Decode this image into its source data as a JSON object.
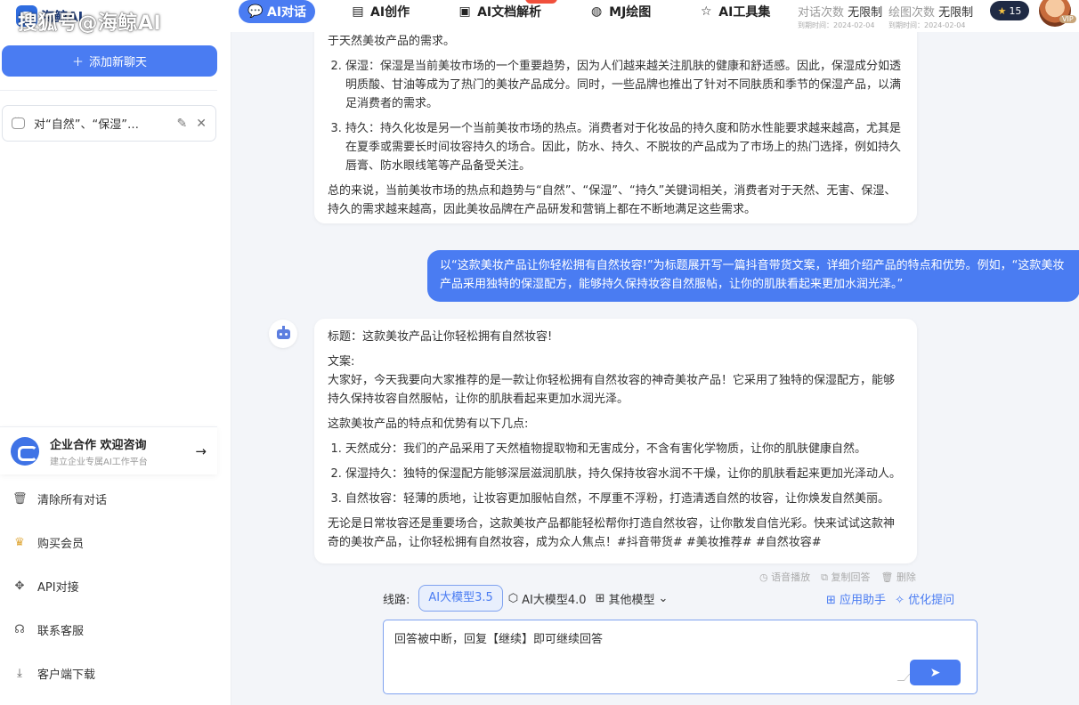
{
  "brand": {
    "name": "海鲸AI",
    "watermark": "搜狐号@海鲸AI"
  },
  "nav": [
    {
      "label": "AI对话",
      "icon": "chat-icon"
    },
    {
      "label": "AI创作",
      "icon": "document-icon"
    },
    {
      "label": "AI文档解析",
      "icon": "pdf-icon"
    },
    {
      "label": "MJ绘图",
      "icon": "palette-icon"
    },
    {
      "label": "AI工具集",
      "icon": "star-icon"
    }
  ],
  "quota": {
    "chat": {
      "label": "对话次数",
      "value": "无限制",
      "expiry": "到期时间：2024-02-04"
    },
    "draw": {
      "label": "绘图次数",
      "value": "无限制",
      "expiry": "到期时间：2024-02-04"
    }
  },
  "user": {
    "stars": "15",
    "vip": "VIP"
  },
  "sidebar": {
    "new_chat": "添加新聊天",
    "conversation_title": "对“自然”、“保湿”…",
    "enterprise": {
      "title": "企业合作 欢迎咨询",
      "subtitle": "建立企业专属AI工作平台"
    },
    "menu": [
      {
        "label": "清除所有对话",
        "icon": "trash-icon"
      },
      {
        "label": "购买会员",
        "icon": "crown-icon"
      },
      {
        "label": "API对接",
        "icon": "api-icon"
      },
      {
        "label": "联系客服",
        "icon": "headset-icon"
      },
      {
        "label": "客户端下载",
        "icon": "download-icon"
      }
    ]
  },
  "messages": {
    "first": {
      "intro_tail": "于天然美妆产品的需求。",
      "items": [
        "保湿：保湿是当前美妆市场的一个重要趋势，因为人们越来越关注肌肤的健康和舒适感。因此，保湿成分如透明质酸、甘油等成为了热门的美妆产品成分。同时，一些品牌也推出了针对不同肤质和季节的保湿产品，以满足消费者的需求。",
        "持久：持久化妆是另一个当前美妆市场的热点。消费者对于化妆品的持久度和防水性能要求越来越高，尤其是在夏季或需要长时间妆容持久的场合。因此，防水、持久、不脱妆的产品成为了市场上的热门选择，例如持久唇膏、防水眼线笔等产品备受关注。"
      ],
      "summary": "总的来说，当前美妆市场的热点和趋势与“自然”、“保湿”、“持久”关键词相关，消费者对于天然、无害、保湿、持久的需求越来越高，因此美妆品牌在产品研发和营销上都在不断地满足这些需求。"
    },
    "user": "以“这款美妆产品让你轻松拥有自然妆容!”为标题展开写一篇抖音带货文案，详细介绍产品的特点和优势。例如，“这款美妆产品采用独特的保湿配方，能够持久保持妆容自然服帖，让你的肌肤看起来更加水润光泽。”",
    "second": {
      "title": "标题：这款美妆产品让你轻松拥有自然妆容!",
      "copy_label": "文案:",
      "copy": "大家好，今天我要向大家推荐的是一款让你轻松拥有自然妆容的神奇美妆产品！它采用了独特的保湿配方，能够持久保持妆容自然服帖，让你的肌肤看起来更加水润光泽。",
      "features_intro": "这款美妆产品的特点和优势有以下几点:",
      "items": [
        "天然成分：我们的产品采用了天然植物提取物和无害成分，不含有害化学物质，让你的肌肤健康自然。",
        "保湿持久：独特的保湿配方能够深层滋润肌肤，持久保持妆容水润不干燥，让你的肌肤看起来更加光泽动人。",
        "自然妆容：轻薄的质地，让妆容更加服帖自然，不厚重不浮粉，打造清透自然的妆容，让你焕发自然美丽。"
      ],
      "closing": "无论是日常妆容还是重要场合，这款美妆产品都能轻松帮你打造自然妆容，让你散发自信光彩。快来试试这款神奇的美妆产品，让你轻松拥有自然妆容，成为众人焦点！#抖音带货# #美妆推荐# #自然妆容#"
    },
    "actions": {
      "voice": "语音播放",
      "copy": "复制回答",
      "delete": "删除"
    }
  },
  "route": {
    "label": "线路:",
    "models": [
      "AI大模型3.5",
      "AI大模型4.0",
      "其他模型"
    ],
    "assistant": "应用助手",
    "optimize": "优化提问"
  },
  "input": {
    "value": "回答被中断，回复【继续】即可继续回答"
  }
}
